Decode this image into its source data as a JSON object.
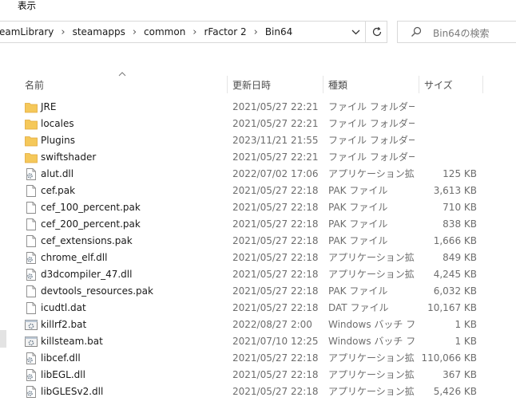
{
  "menu": {
    "view": "表示"
  },
  "address": {
    "crumbs": [
      "eamLibrary",
      "steamapps",
      "common",
      "rFactor 2",
      "Bin64"
    ],
    "separator": "›"
  },
  "search": {
    "placeholder": "Bin64の検索"
  },
  "columns": {
    "name": "名前",
    "date": "更新日時",
    "type": "種類",
    "size": "サイズ"
  },
  "icons": {
    "folder": "folder-icon",
    "dll": "dll-file-icon",
    "file": "generic-file-icon",
    "bat": "batch-file-icon"
  },
  "colors": {
    "folder": "#f5c85a",
    "folder_dark": "#e1a93a",
    "text_secondary": "#6d6d6d"
  },
  "files": [
    {
      "icon": "folder",
      "name": "JRE",
      "date": "2021/05/27 22:21",
      "type": "ファイル フォルダー",
      "size": ""
    },
    {
      "icon": "folder",
      "name": "locales",
      "date": "2021/05/27 22:21",
      "type": "ファイル フォルダー",
      "size": ""
    },
    {
      "icon": "folder",
      "name": "Plugins",
      "date": "2023/11/21 21:55",
      "type": "ファイル フォルダー",
      "size": ""
    },
    {
      "icon": "folder",
      "name": "swiftshader",
      "date": "2021/05/27 22:21",
      "type": "ファイル フォルダー",
      "size": ""
    },
    {
      "icon": "dll",
      "name": "alut.dll",
      "date": "2022/07/02 17:06",
      "type": "アプリケーション拡張",
      "size": "125 KB"
    },
    {
      "icon": "file",
      "name": "cef.pak",
      "date": "2021/05/27 22:18",
      "type": "PAK ファイル",
      "size": "3,613 KB"
    },
    {
      "icon": "file",
      "name": "cef_100_percent.pak",
      "date": "2021/05/27 22:18",
      "type": "PAK ファイル",
      "size": "710 KB"
    },
    {
      "icon": "file",
      "name": "cef_200_percent.pak",
      "date": "2021/05/27 22:18",
      "type": "PAK ファイル",
      "size": "838 KB"
    },
    {
      "icon": "file",
      "name": "cef_extensions.pak",
      "date": "2021/05/27 22:18",
      "type": "PAK ファイル",
      "size": "1,666 KB"
    },
    {
      "icon": "dll",
      "name": "chrome_elf.dll",
      "date": "2021/05/27 22:18",
      "type": "アプリケーション拡張",
      "size": "849 KB"
    },
    {
      "icon": "dll",
      "name": "d3dcompiler_47.dll",
      "date": "2021/05/27 22:18",
      "type": "アプリケーション拡張",
      "size": "4,245 KB"
    },
    {
      "icon": "file",
      "name": "devtools_resources.pak",
      "date": "2021/05/27 22:18",
      "type": "PAK ファイル",
      "size": "6,032 KB"
    },
    {
      "icon": "file",
      "name": "icudtl.dat",
      "date": "2021/05/27 22:18",
      "type": "DAT ファイル",
      "size": "10,167 KB"
    },
    {
      "icon": "bat",
      "name": "killrf2.bat",
      "date": "2022/08/27 2:00",
      "type": "Windows バッチ ファ...",
      "size": "1 KB"
    },
    {
      "icon": "bat",
      "name": "killsteam.bat",
      "date": "2021/07/10 12:25",
      "type": "Windows バッチ ファ...",
      "size": "1 KB"
    },
    {
      "icon": "dll",
      "name": "libcef.dll",
      "date": "2021/05/27 22:18",
      "type": "アプリケーション拡張",
      "size": "110,066 KB"
    },
    {
      "icon": "dll",
      "name": "libEGL.dll",
      "date": "2021/05/27 22:18",
      "type": "アプリケーション拡張",
      "size": "367 KB"
    },
    {
      "icon": "dll",
      "name": "libGLESv2.dll",
      "date": "2021/05/27 22:18",
      "type": "アプリケーション拡張",
      "size": "5,426 KB"
    }
  ]
}
